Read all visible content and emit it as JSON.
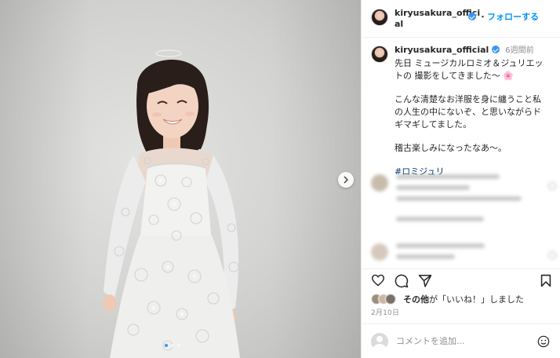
{
  "post": {
    "username": "kiryusakura_official",
    "follow_label": "フォローする",
    "separator": "・",
    "caption": {
      "username": "kiryusakura_official",
      "time_ago": "6週間前",
      "line1": "先日 ミュージカルロミオ＆ジュリエットの 撮影をしてきました〜",
      "flower": "🌸",
      "para2": "こんな清楚なお洋服を身に纏うこと私の人生の中にないぞ、と思いながらドギマギしてました。",
      "para3": "稽古楽しみになったなあ〜。",
      "hashtag": "#ロミジュリ"
    },
    "likes": {
      "prefix": "その他",
      "suffix": "が「いいね！」しました"
    },
    "date": "2月10日",
    "comment_placeholder": "コメントを追加..."
  },
  "carousel": {
    "total_slides": 3,
    "active_index": 0
  },
  "colors": {
    "accent": "#0095f6",
    "verified": "#3897f0",
    "hashtag": "#00376b"
  },
  "icons": [
    "next-arrow-icon",
    "verified-badge-icon",
    "heart-icon",
    "comment-icon",
    "share-icon",
    "bookmark-icon",
    "emoji-icon"
  ]
}
